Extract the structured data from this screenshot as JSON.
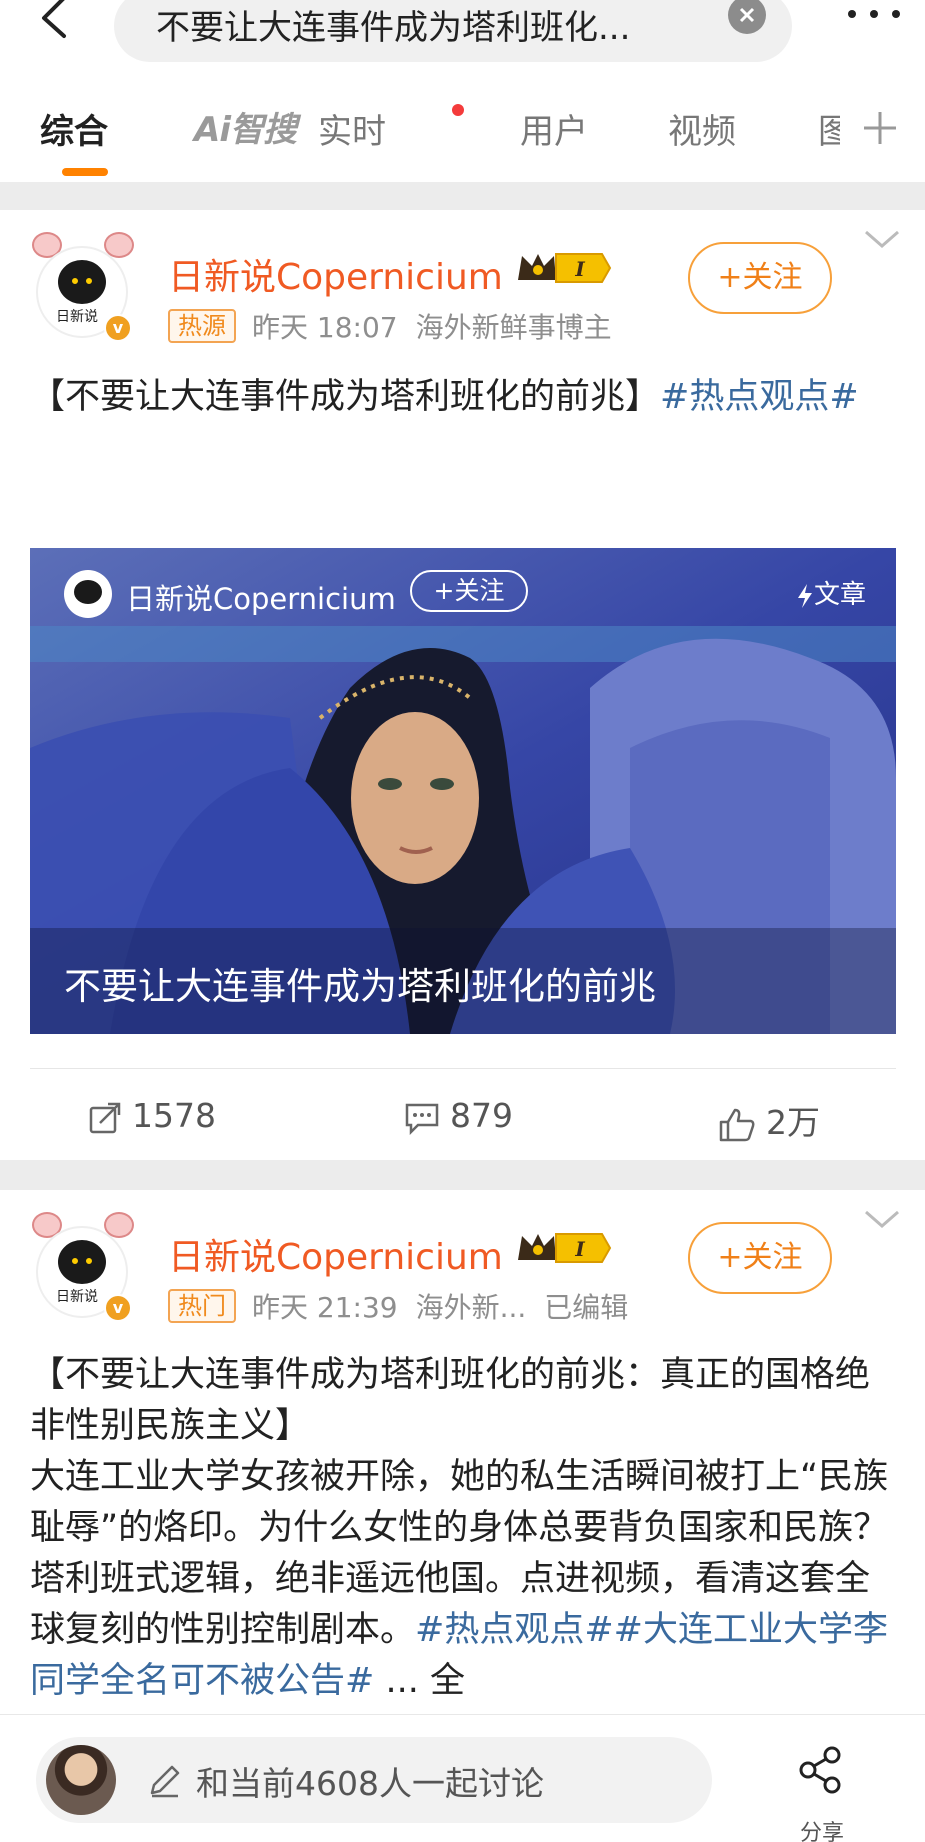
{
  "search": {
    "query": "不要让大连事件成为塔利班化..."
  },
  "tabs": [
    {
      "label": "综合"
    },
    {
      "label": "Ai智搜"
    },
    {
      "label": "实时"
    },
    {
      "label": "用户"
    },
    {
      "label": "视频"
    },
    {
      "label": "图"
    }
  ],
  "posts": [
    {
      "author": "日新说Copernicium",
      "avatar_text": "日新说",
      "level_badge": "I",
      "follow_label": "+关注",
      "tag": "热源",
      "time": "昨天 18:07",
      "info": "海外新鲜事博主",
      "edited": "",
      "text_main": "【不要让大连事件成为塔利班化的前兆】",
      "hashtag": "#热点观点#",
      "article": {
        "author": "日新说Copernicium",
        "follow_label": "+关注",
        "badge": "文章",
        "title": "不要让大连事件成为塔利班化的前兆"
      },
      "reposts": "1578",
      "comments": "879",
      "likes": "2万"
    },
    {
      "author": "日新说Copernicium",
      "avatar_text": "日新说",
      "level_badge": "I",
      "follow_label": "+关注",
      "tag": "热门",
      "time": "昨天 21:39",
      "info": "海外新...",
      "edited": "已编辑",
      "line1": "【不要让大连事件成为塔利班化的前兆：真正的国格绝非性别民族主义】",
      "line2": "大连工业大学女孩被开除，她的私生活瞬间被打上“民族耻辱”的烙印。为什么女性的身体总要背负国家和民族？塔利班式逻辑，绝非遥远他国。点进视频，看清这套全球复刻的性别控制剧本。",
      "hashtag1": "#热点观点#",
      "hashtag2": "#大连工业大学李同学全名可不被公告#",
      "more": "... 全"
    }
  ],
  "bottom": {
    "discuss_text": "和当前4608人一起讨论",
    "share_label": "分享"
  },
  "colors": {
    "accent": "#ff8200",
    "username": "#f05a23",
    "hashtag": "#3a6a9e"
  }
}
